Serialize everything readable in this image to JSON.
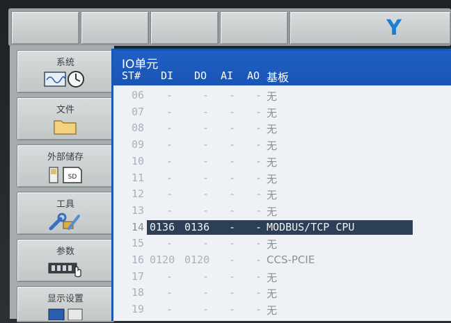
{
  "top_softkey_glyph": "Y",
  "menu": [
    {
      "label": "系统",
      "icon": "system-clock-icon"
    },
    {
      "label": "文件",
      "icon": "folder-icon"
    },
    {
      "label": "外部储存",
      "icon": "sd-card-icon"
    },
    {
      "label": "工具",
      "icon": "tools-icon"
    },
    {
      "label": "参数",
      "icon": "parameter-icon"
    },
    {
      "label": "显示设置",
      "icon": "display-settings-icon"
    }
  ],
  "io_panel": {
    "title": "IO单元",
    "headers": {
      "st": "ST#",
      "di": "DI",
      "do": "DO",
      "ai": "AI",
      "ao": "AO",
      "board": "基板"
    },
    "rows": [
      {
        "st": "06",
        "di": "-",
        "do": "-",
        "ai": "-",
        "ao": "-",
        "board": "无"
      },
      {
        "st": "07",
        "di": "-",
        "do": "-",
        "ai": "-",
        "ao": "-",
        "board": "无"
      },
      {
        "st": "08",
        "di": "-",
        "do": "-",
        "ai": "-",
        "ao": "-",
        "board": "无"
      },
      {
        "st": "09",
        "di": "-",
        "do": "-",
        "ai": "-",
        "ao": "-",
        "board": "无"
      },
      {
        "st": "10",
        "di": "-",
        "do": "-",
        "ai": "-",
        "ao": "-",
        "board": "无"
      },
      {
        "st": "11",
        "di": "-",
        "do": "-",
        "ai": "-",
        "ao": "-",
        "board": "无"
      },
      {
        "st": "12",
        "di": "-",
        "do": "-",
        "ai": "-",
        "ao": "-",
        "board": "无"
      },
      {
        "st": "13",
        "di": "-",
        "do": "-",
        "ai": "-",
        "ao": "-",
        "board": "无"
      },
      {
        "st": "14",
        "di": "0136",
        "do": "0136",
        "ai": "-",
        "ao": "-",
        "board": "MODBUS/TCP CPU",
        "selected": true
      },
      {
        "st": "15",
        "di": "-",
        "do": "-",
        "ai": "-",
        "ao": "-",
        "board": "无"
      },
      {
        "st": "16",
        "di": "0120",
        "do": "0120",
        "ai": "-",
        "ao": "-",
        "board": "CCS-PCIE"
      },
      {
        "st": "17",
        "di": "-",
        "do": "-",
        "ai": "-",
        "ao": "-",
        "board": "无"
      },
      {
        "st": "18",
        "di": "-",
        "do": "-",
        "ai": "-",
        "ao": "-",
        "board": "无"
      },
      {
        "st": "19",
        "di": "-",
        "do": "-",
        "ai": "-",
        "ao": "-",
        "board": "无"
      }
    ]
  },
  "colors": {
    "header_blue": "#1a55b5",
    "selection": "#2c3f57",
    "accent_y": "#1d7fd1"
  }
}
